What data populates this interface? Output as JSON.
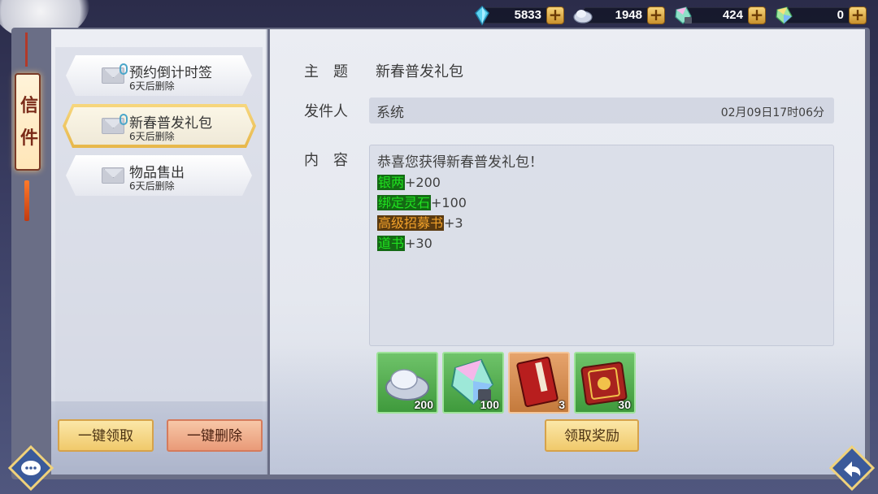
{
  "currencies": [
    {
      "icon": "crystal-icon",
      "value": "5833"
    },
    {
      "icon": "silver-ingot-icon",
      "value": "1948"
    },
    {
      "icon": "locked-gem-icon",
      "value": "424"
    },
    {
      "icon": "rainbow-gem-icon",
      "value": "0"
    }
  ],
  "side_tab": {
    "chars": [
      "信",
      "件"
    ]
  },
  "mail_list": [
    {
      "title": "预约倒计时签",
      "sub": "6天后删除",
      "selected": false,
      "has_clip": true
    },
    {
      "title": "新春普发礼包",
      "sub": "6天后删除",
      "selected": true,
      "has_clip": true
    },
    {
      "title": "物品售出",
      "sub": "6天后删除",
      "selected": false,
      "has_clip": false
    }
  ],
  "left_buttons": {
    "claim_all": "一键领取",
    "delete_all": "一键删除"
  },
  "detail": {
    "subject_label": "主　题",
    "subject": "新春普发礼包",
    "sender_label": "发件人",
    "sender": "系统",
    "date": "02月09日17时06分",
    "content_label": "内　容",
    "content_intro": "恭喜您获得新春普发礼包！",
    "content_lines": [
      {
        "name": "银两",
        "amount": "+200",
        "color": "green"
      },
      {
        "name": "绑定灵石",
        "amount": "+100",
        "color": "green"
      },
      {
        "name": "高级招募书",
        "amount": "+3",
        "color": "orange"
      },
      {
        "name": "道书",
        "amount": "+30",
        "color": "green"
      }
    ]
  },
  "rewards": [
    {
      "icon": "silver-ingot-icon",
      "qty": "200",
      "frame": "green"
    },
    {
      "icon": "locked-gem-icon",
      "qty": "100",
      "frame": "green"
    },
    {
      "icon": "recruit-book-icon",
      "qty": "3",
      "frame": "orange"
    },
    {
      "icon": "dao-book-icon",
      "qty": "30",
      "frame": "green"
    }
  ],
  "claim_button": "领取奖励",
  "colors": {
    "gold_button": "#f0c96b",
    "red_button": "#e99a78",
    "highlight_green": "#20e020",
    "highlight_orange": "#f2a22a"
  }
}
